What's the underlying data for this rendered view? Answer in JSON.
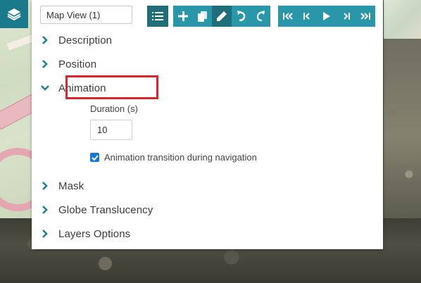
{
  "toolbar": {
    "view_name": "Map View (1)",
    "buttons": [
      "list-icon",
      "add-icon",
      "copy-icon",
      "pencil-icon",
      "undo-icon",
      "redo-icon",
      "first-icon",
      "previous-icon",
      "play-icon",
      "next-icon",
      "last-icon"
    ]
  },
  "sections": {
    "description": "Description",
    "position": "Position",
    "animation": "Animation",
    "mask": "Mask",
    "globe_translucency": "Globe Translucency",
    "layers_options": "Layers Options"
  },
  "animation": {
    "duration_label": "Duration (s)",
    "duration_value": "10",
    "transition_label": "Animation transition during navigation",
    "transition_checked": true
  },
  "colors": {
    "accent": "#2a96a9",
    "accent_dark": "#1f6f7a",
    "highlight": "#e0222c",
    "checkbox": "#1877d2"
  }
}
